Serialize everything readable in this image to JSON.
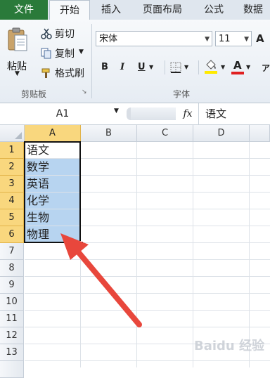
{
  "ribbon_tabs": [
    "文件",
    "开始",
    "插入",
    "页面布局",
    "公式",
    "数据"
  ],
  "clipboard": {
    "paste": "粘贴",
    "cut": "剪切",
    "copy": "复制",
    "format_painter": "格式刷",
    "group": "剪贴板"
  },
  "font": {
    "name": "宋体",
    "size": "11",
    "group": "字体",
    "bold": "B",
    "italic": "I",
    "underline": "U",
    "grow": "A",
    "shrink": "A",
    "font_color_letter": "A"
  },
  "formula_bar": {
    "name_box": "A1",
    "fx": "fx",
    "content": "语文"
  },
  "sheet": {
    "columns": [
      "A",
      "B",
      "C",
      "D"
    ],
    "rows": [
      "1",
      "2",
      "3",
      "4",
      "5",
      "6",
      "7",
      "8",
      "9",
      "10",
      "11",
      "12",
      "13"
    ],
    "cells_A": [
      "语文",
      "数学",
      "英语",
      "化学",
      "生物",
      "物理"
    ]
  },
  "colors": {
    "file_tab": "#2a7a3a",
    "selection_fill": "#b7d4f0",
    "header_highlight": "#f9d77e",
    "arrow": "#e8473c"
  },
  "watermark": "Baidu 经验"
}
